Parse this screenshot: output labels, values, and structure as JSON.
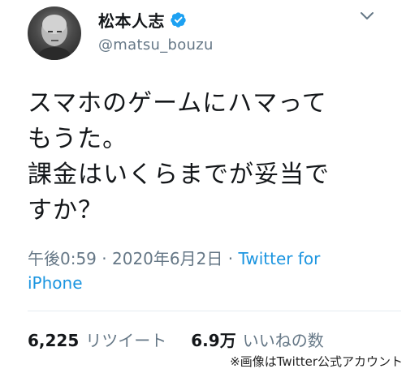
{
  "user": {
    "display_name": "松本人志",
    "handle": "@matsu_bouzu",
    "verified_icon": "verified-badge-icon",
    "verified_color": "#1da1f2"
  },
  "menu_icon": "chevron-down-icon",
  "tweet": {
    "text": "スマホのゲームにハマって\nもうた。\n課金はいくらまでが妥当で\nすか？",
    "time": "午後0:59",
    "date": "2020年6月2日",
    "separator": " · ",
    "via": "Twitter for iPhone"
  },
  "stats": {
    "retweets": {
      "count": "6,225",
      "label": "リツイート"
    },
    "likes": {
      "count": "6.9万",
      "label": "いいねの数"
    }
  },
  "credit": "※画像はTwitter公式アカウント",
  "colors": {
    "text": "#14171a",
    "secondary": "#657786",
    "link": "#1b95e0",
    "divider": "#e6ecf0"
  }
}
